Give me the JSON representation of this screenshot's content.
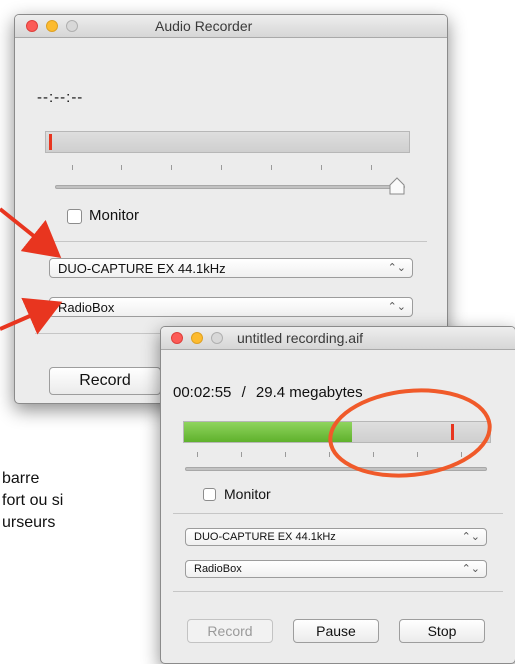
{
  "bg_text": {
    "line1": "barre",
    "line2": "fort ou si",
    "line3": "urseurs"
  },
  "window1": {
    "title": "Audio Recorder",
    "time": "--:--:--",
    "monitor_label": "Monitor",
    "input_device": "DUO-CAPTURE EX 44.1kHz",
    "output_device": "RadioBox",
    "record_label": "Record",
    "select_arrow": "⌃⌄"
  },
  "window2": {
    "title": "untitled recording.aif",
    "time": "00:02:55",
    "separator": "/",
    "size": "29.4 megabytes",
    "level": 0.55,
    "monitor_label": "Monitor",
    "input_device": "DUO-CAPTURE EX 44.1kHz",
    "output_device": "RadioBox",
    "record_label": "Record",
    "pause_label": "Pause",
    "stop_label": "Stop",
    "select_arrow": "⌃⌄"
  },
  "colors": {
    "level_green": "#6fc23a",
    "peak_red": "#e8351f",
    "annotation_red": "#e8351f",
    "annotation_ellipse": "#f05a2a"
  },
  "icons": [
    "close-icon",
    "minimize-icon",
    "zoom-icon",
    "arrow-annotation",
    "ellipse-annotation"
  ]
}
